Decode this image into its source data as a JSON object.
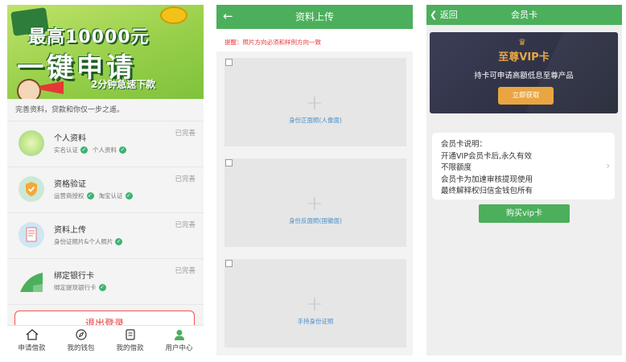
{
  "panel1": {
    "banner": {
      "line1": "最高10000元",
      "line2": "一键申请",
      "line3": "2分钟急速下款"
    },
    "tip": "完善资料，贷款和你仅一步之遥。",
    "items": [
      {
        "title": "个人资料",
        "status": "已完善",
        "subs": [
          "实名认证",
          "个人资料"
        ],
        "icon": "profile-icon"
      },
      {
        "title": "资格验证",
        "status": "已完善",
        "subs": [
          "运营商授权",
          "淘宝认证"
        ],
        "icon": "shield-icon"
      },
      {
        "title": "资料上传",
        "status": "已完善",
        "subs": [
          "身份证照片&个人照片"
        ],
        "icon": "document-icon"
      },
      {
        "title": "绑定银行卡",
        "status": "已完善",
        "subs": [
          "绑定提现银行卡"
        ],
        "icon": "bank-card-icon"
      }
    ],
    "logout": "退出登录",
    "tabs": [
      {
        "label": "申请借款",
        "icon": "home-icon"
      },
      {
        "label": "我的钱包",
        "icon": "compass-icon"
      },
      {
        "label": "我的借款",
        "icon": "bill-icon"
      },
      {
        "label": "用户中心",
        "icon": "user-icon"
      }
    ]
  },
  "panel2": {
    "back": "←",
    "title": "资料上传",
    "warning": "提醒：照片方向必须和样例方向一致",
    "uploads": [
      {
        "caption": "身份正面照(人像面)"
      },
      {
        "caption": "身份反面照(国徽面)"
      },
      {
        "caption": "手持身份证照"
      }
    ]
  },
  "panel3": {
    "back": "返回",
    "title": "会员卡",
    "card": {
      "name": "至尊VIP卡",
      "desc": "持卡可申请高额低息至尊产品",
      "button": "立即获取"
    },
    "info": [
      "会员卡说明：",
      "开通VIP会员卡后,永久有效",
      "不限额度",
      "会员卡为加速审核提现使用",
      "最终解释权归信金钱包所有"
    ],
    "buy": "购买vip卡"
  },
  "colors": {
    "header_green": "#4caf5c",
    "check_green": "#3cb371",
    "gold": "#e9a541",
    "card_dark": "#2c2f42",
    "warning_red": "#e53935",
    "link_blue": "#4a90c9"
  }
}
